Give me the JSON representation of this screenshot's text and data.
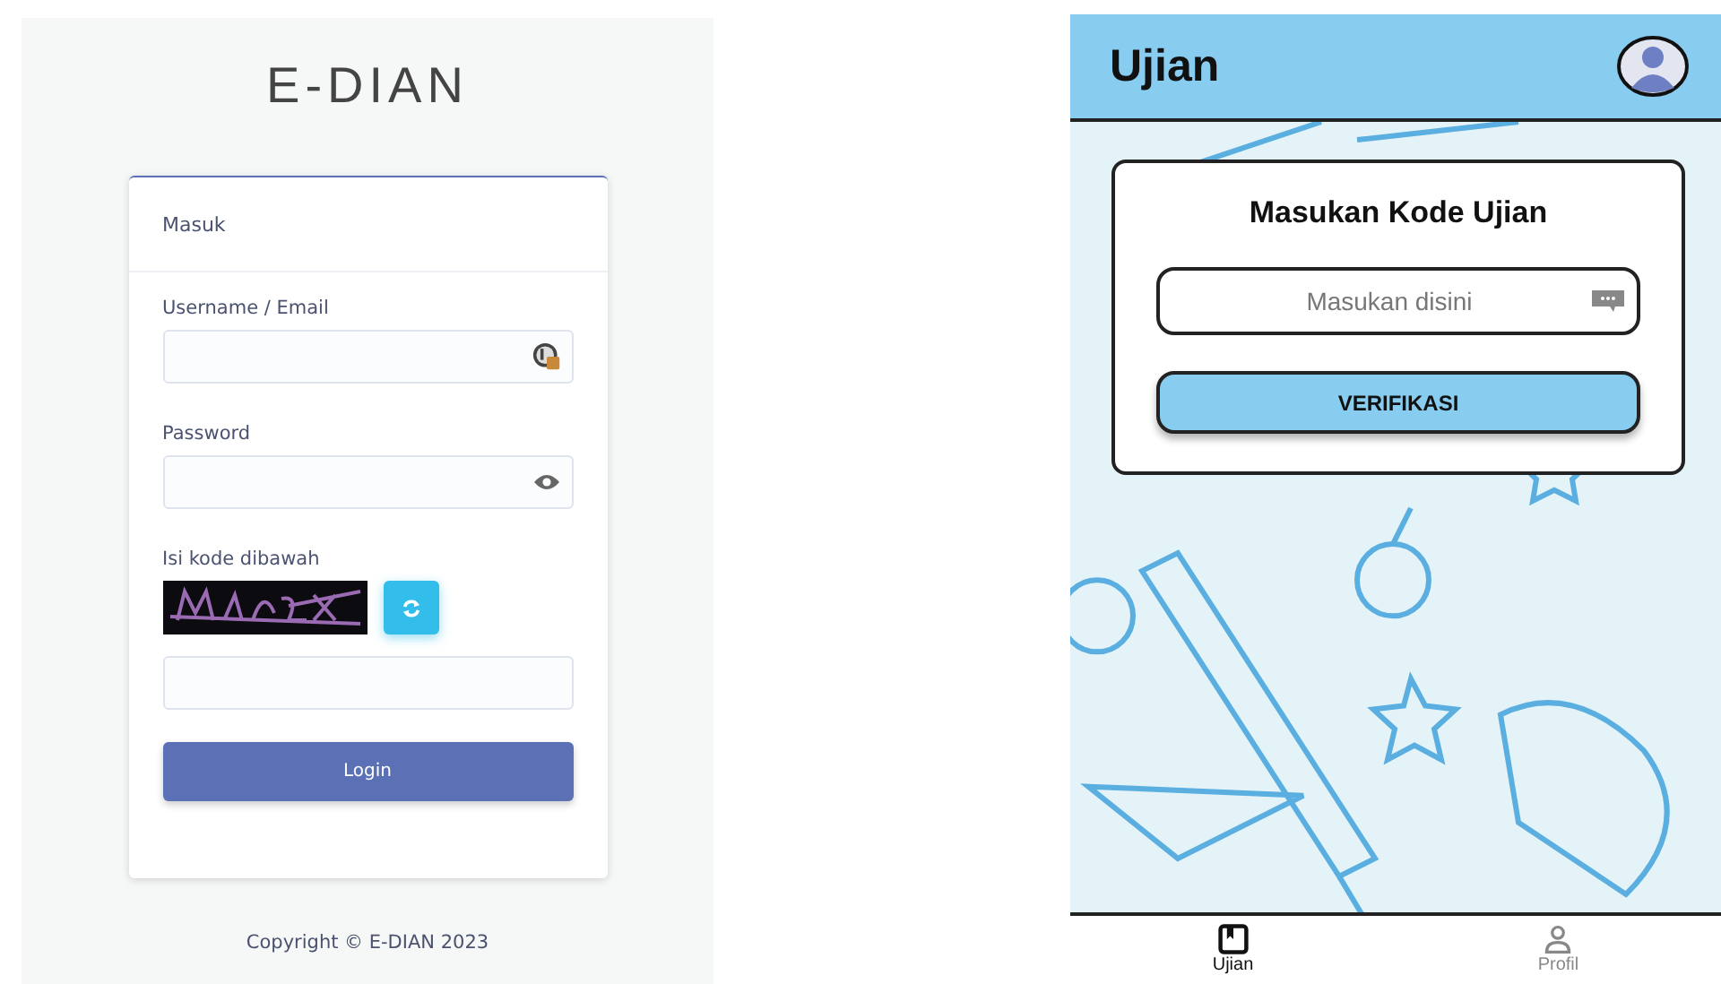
{
  "login_page": {
    "brand": "E-DIAN",
    "card_title": "Masuk",
    "fields": [
      {
        "label": "Username / Email",
        "kind": "user"
      },
      {
        "label": "Password",
        "kind": "password"
      }
    ],
    "captcha": {
      "label": "Isi kode dibawah"
    },
    "login_button": "Login",
    "footer": "Copyright © E-DIAN 2023"
  },
  "exam_app": {
    "title": "Ujian",
    "dialog": {
      "title": "Masukan Kode Ujian",
      "placeholder": "Masukan disini",
      "button": "VERIFIKASI"
    },
    "nav": [
      {
        "label": "Ujian",
        "kind": "book",
        "selected": true
      },
      {
        "label": "Profil",
        "kind": "person",
        "selected": false
      }
    ]
  }
}
